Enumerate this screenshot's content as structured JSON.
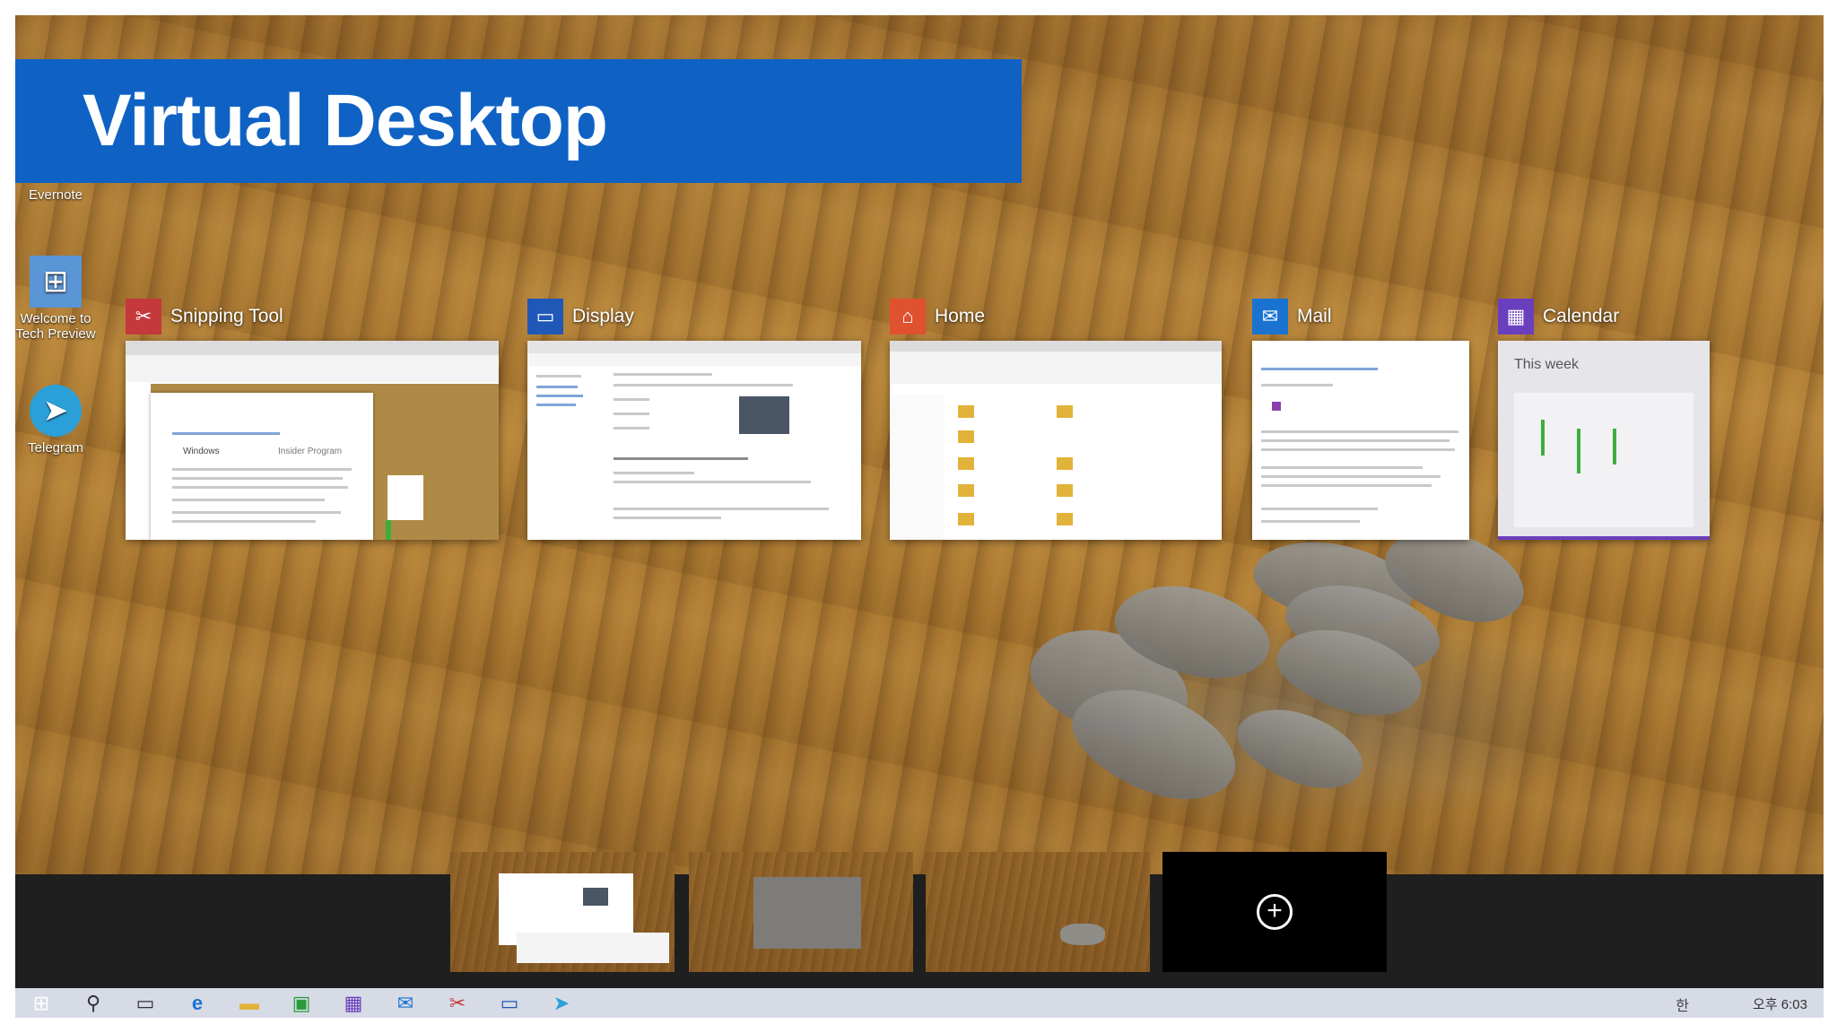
{
  "title": "Virtual Desktop",
  "desktop_icons": [
    {
      "label": "Evernote",
      "icon": "evernote-icon"
    },
    {
      "label": "Welcome to Tech Preview",
      "icon": "windows-icon"
    },
    {
      "label": "Telegram",
      "icon": "telegram-icon"
    }
  ],
  "windows": [
    {
      "label": "Snipping Tool",
      "icon": "scissors-icon",
      "color": "#c5383b"
    },
    {
      "label": "Display",
      "icon": "monitor-icon",
      "color": "#1f58b7"
    },
    {
      "label": "Home",
      "icon": "home-icon",
      "color": "#e0512f"
    },
    {
      "label": "Mail",
      "icon": "envelope-icon",
      "color": "#1a73d1"
    },
    {
      "label": "Calendar",
      "icon": "calendar-icon",
      "color": "#6a3fbd"
    }
  ],
  "calendar_preview": {
    "heading": "This week"
  },
  "snipping_preview": {
    "brand": "Windows",
    "program": "Insider Program"
  },
  "virtual_desktops": {
    "count": 3,
    "add_icon": "plus-circle-icon"
  },
  "taskbar": {
    "items": [
      "start-icon",
      "search-icon",
      "task-view-icon",
      "ie-icon",
      "file-explorer-icon",
      "store-icon",
      "calendar-icon",
      "mail-icon",
      "snipping-icon",
      "display-icon",
      "telegram-icon"
    ],
    "clock": "오후 6:03",
    "ime": "한"
  },
  "colors": {
    "banner": "#0f62c4",
    "taskbar": "#d7dbe6",
    "vd_bar": "#1f1f1f"
  }
}
